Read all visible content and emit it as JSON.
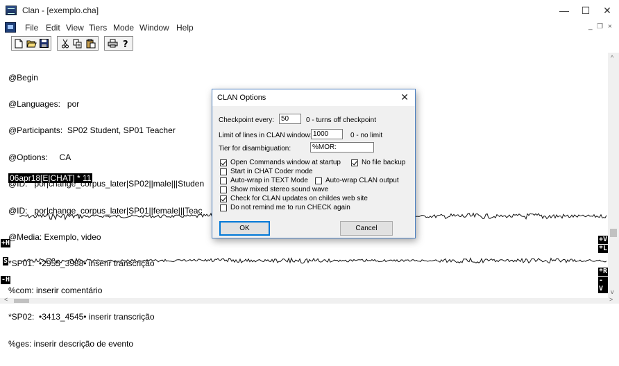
{
  "window": {
    "title": "Clan - [exemplo.cha]",
    "controls": {
      "minimize": "—",
      "maximize": "☐",
      "close": "✕"
    }
  },
  "menubar": {
    "items": [
      "File",
      "Edit",
      "View",
      "Tiers",
      "Mode",
      "Window",
      "Help"
    ],
    "mdi_controls": {
      "minimize": "_",
      "restore": "❐",
      "close": "×"
    }
  },
  "toolbar": {
    "buttons": [
      "new-icon",
      "open-folder-icon",
      "save-icon",
      "cut-icon",
      "copy-icon",
      "paste-icon",
      "print-icon",
      "help-icon"
    ]
  },
  "document": {
    "lines": [
      "@Begin",
      "@Languages:   por",
      "@Participants:  SP02 Student, SP01 Teacher",
      "@Options:     CA",
      "@ID:   por|change_corpus_later|SP02||male|||Studen",
      "@ID:   por|change_corpus_later|SP01||female|||Teac",
      "@Media: Exemplo, video",
      "*SP01:  •2955_3988• inserir transcrição",
      "%com: inserir comentário",
      "*SP02:  •3413_4545• inserir transcrição",
      "%ges: inserir descrição de evento"
    ],
    "timestamp_bar": "06apr18[E|CHAT] * 11"
  },
  "wave_tags": {
    "left": [
      "+H",
      "S",
      "-H"
    ],
    "right": [
      "+V",
      "*L",
      "*R",
      "-V"
    ]
  },
  "dialog": {
    "title": "CLAN Options",
    "close": "✕",
    "checkpoint_label": "Checkpoint every:",
    "checkpoint_value": "50",
    "checkpoint_hint": "0 - turns off checkpoint",
    "limit_label": "Limit of lines in CLAN window:",
    "limit_value": "1000",
    "limit_hint": "0 - no limit",
    "tier_label": "Tier for disambiguation:",
    "tier_value": "%MOR:",
    "checkboxes": [
      {
        "label": "Open Commands window at startup",
        "checked": true
      },
      {
        "label": "No file backup",
        "checked": true
      },
      {
        "label": "Start in CHAT Coder mode",
        "checked": false
      },
      {
        "label": "Auto-wrap in TEXT Mode",
        "checked": false
      },
      {
        "label": "Auto-wrap CLAN output",
        "checked": false
      },
      {
        "label": "Show mixed stereo sound wave",
        "checked": false
      },
      {
        "label": "Check for CLAN updates on childes web site",
        "checked": true
      },
      {
        "label": "Do not remind me to run CHECK again",
        "checked": false
      }
    ],
    "ok_label": "OK",
    "cancel_label": "Cancel"
  },
  "scroll": {
    "up": "^",
    "down": "v",
    "left": "<",
    "right": ">"
  }
}
